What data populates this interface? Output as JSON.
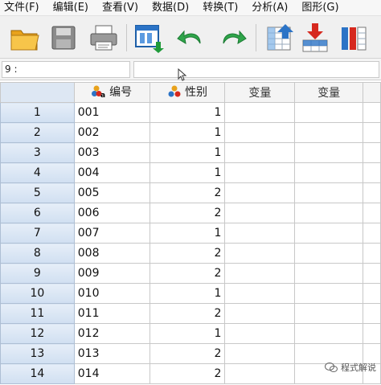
{
  "menu": {
    "items": [
      "文件(F)",
      "编辑(E)",
      "查看(V)",
      "数据(D)",
      "转换(T)",
      "分析(A)",
      "图形(G)"
    ]
  },
  "toolbar": {
    "buttons": [
      "open-folder-icon",
      "save-icon",
      "print-icon",
      "recall-dialog-icon",
      "undo-icon",
      "redo-icon",
      "goto-case-icon",
      "insert-case-icon",
      "variables-icon"
    ]
  },
  "editor": {
    "cell_ref": "9 :",
    "cell_value": ""
  },
  "grid": {
    "columns": [
      {
        "name": "编号",
        "type": "string",
        "icon": "string-var-icon"
      },
      {
        "name": "性别",
        "type": "nominal",
        "icon": "nominal-var-icon"
      },
      {
        "name": "变量",
        "type": "empty"
      },
      {
        "name": "变量",
        "type": "empty"
      }
    ],
    "rows": [
      {
        "num": "1",
        "id": "001",
        "sex": "1"
      },
      {
        "num": "2",
        "id": "002",
        "sex": "1"
      },
      {
        "num": "3",
        "id": "003",
        "sex": "1"
      },
      {
        "num": "4",
        "id": "004",
        "sex": "1"
      },
      {
        "num": "5",
        "id": "005",
        "sex": "2"
      },
      {
        "num": "6",
        "id": "006",
        "sex": "2"
      },
      {
        "num": "7",
        "id": "007",
        "sex": "1"
      },
      {
        "num": "8",
        "id": "008",
        "sex": "2"
      },
      {
        "num": "9",
        "id": "009",
        "sex": "2"
      },
      {
        "num": "10",
        "id": "010",
        "sex": "1"
      },
      {
        "num": "11",
        "id": "011",
        "sex": "2"
      },
      {
        "num": "12",
        "id": "012",
        "sex": "1"
      },
      {
        "num": "13",
        "id": "013",
        "sex": "2"
      },
      {
        "num": "14",
        "id": "014",
        "sex": "2"
      }
    ]
  },
  "watermark": {
    "text": "程式解说"
  },
  "colors": {
    "row_header": "#d9e6f5",
    "corner": "#dde7f3",
    "grid_line": "#c8c8c8"
  }
}
